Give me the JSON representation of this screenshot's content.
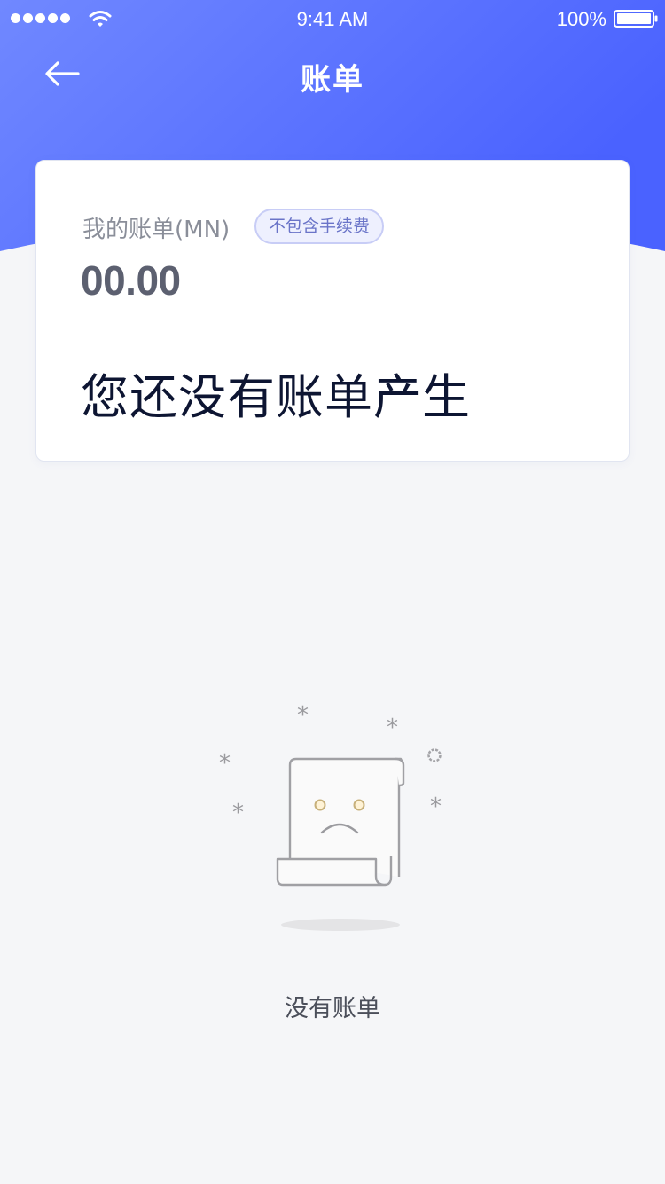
{
  "status_bar": {
    "time": "9:41 AM",
    "battery": "100%",
    "icons": [
      "signal-icon",
      "wifi-icon",
      "battery-icon"
    ]
  },
  "nav": {
    "title": "账单",
    "back_icon": "back-arrow-icon"
  },
  "bill_card": {
    "label": "我的账单(MN)",
    "fee_badge": "不包含手续费",
    "amount": "00.00",
    "empty_message": "您还没有账单产生"
  },
  "empty_state": {
    "icon": "sad-scroll-icon",
    "text": "没有账单"
  },
  "colors": {
    "header_gradient_start": "#6f85ff",
    "header_gradient_end": "#4a62ff",
    "background": "#f5f6f8",
    "card_background": "#ffffff",
    "badge_border": "#c8cdf6",
    "badge_text": "#6a74c8"
  }
}
